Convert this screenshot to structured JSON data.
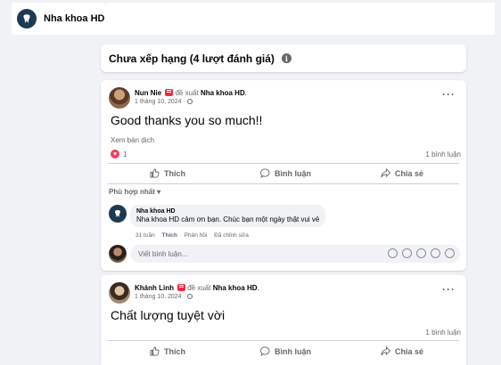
{
  "topbar": {
    "page_name": "Nha khoa HD"
  },
  "reviews_header": {
    "title": "Chưa xếp hạng (4 lượt đánh giá)",
    "info_icon": "info-icon"
  },
  "reviews": [
    {
      "author": "Nun Nie",
      "verb": "đề xuất",
      "target": "Nha khoa HD",
      "date": "1 tháng 10, 2024 ·",
      "text": "Good thanks you so much!!",
      "translate": "Xem bản dịch",
      "reactions": "1",
      "comments_count": "1 bình luận",
      "actions": {
        "like": "Thích",
        "comment": "Bình luận",
        "share": "Chia sẻ"
      },
      "sort_label": "Phù hợp nhất",
      "reply": {
        "author": "Nha khoa HD",
        "text": "Nha khoa HD cảm ơn bạn. Chúc bạn một ngày thật vui vẻ",
        "time": "31 tuần",
        "like": "Thích",
        "reply": "Phản hồi",
        "edited": "Đã chỉnh sửa"
      },
      "input_placeholder": "Viết bình luận..."
    },
    {
      "author": "Khánh Linh",
      "verb": "đề xuất",
      "target": "Nha khoa HD",
      "date": "1 tháng 10, 2024 ·",
      "text": "Chất lượng tuyệt vời",
      "comments_count": "1 bình luận",
      "actions": {
        "like": "Thích",
        "comment": "Bình luận",
        "share": "Chia sẻ"
      }
    }
  ],
  "colors": {
    "accent_red": "#f02849",
    "heart": "#f33e58",
    "brand_logo": "#1d3a52",
    "background": "#f0f2f5"
  }
}
